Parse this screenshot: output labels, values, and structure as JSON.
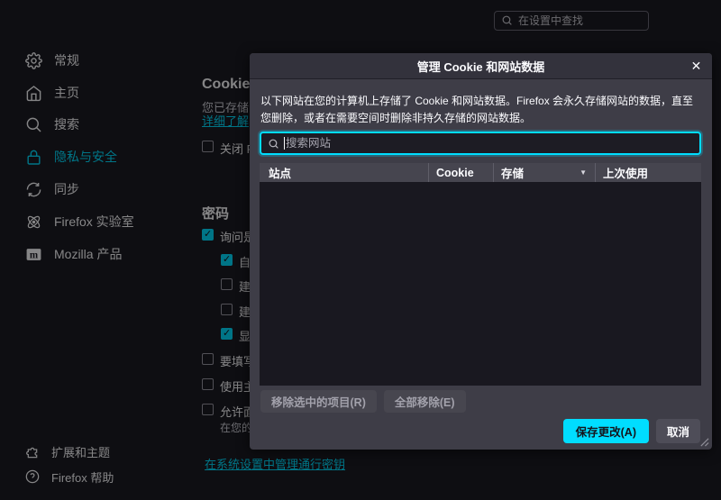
{
  "colors": {
    "accent": "#00ddff",
    "page_bg": "#1c1b22",
    "dialog_bg": "#3e3d47",
    "dialog_titlebar_bg": "#33323c",
    "table_header_bg": "#46454f",
    "table_body_bg": "#191820",
    "primary_button_text": "#15141a"
  },
  "page": {
    "top_search": {
      "placeholder": "在设置中查找"
    },
    "sidebar": {
      "items": [
        {
          "label": "常规"
        },
        {
          "label": "主页"
        },
        {
          "label": "搜索"
        },
        {
          "label": "隐私与安全"
        },
        {
          "label": "同步"
        },
        {
          "label": "Firefox 实验室"
        },
        {
          "label": "Mozilla 产品"
        }
      ],
      "footer": [
        {
          "label": "扩展和主题"
        },
        {
          "label": "Firefox 帮助"
        }
      ]
    },
    "content": {
      "cookie_heading": "Cookie",
      "cookie_desc": "您已存储的",
      "learn_more": "详细了解",
      "close_firefox_checkbox": "关闭 F",
      "passwords_heading": "密码",
      "checkboxes": [
        {
          "label": "询问是",
          "checked": true
        },
        {
          "label": "自",
          "checked": true
        },
        {
          "label": "建",
          "checked": false
        },
        {
          "label": "建",
          "checked": false
        },
        {
          "label": "显",
          "checked": true
        },
        {
          "label": "要填写",
          "checked": false
        },
        {
          "label": "使用主",
          "checked": false
        },
        {
          "label": "允许面",
          "checked": false
        }
      ],
      "checkbox_subtext": "在您的",
      "passkeys_link": "在系统设置中管理通行密钥"
    }
  },
  "dialog": {
    "title": "管理 Cookie 和网站数据",
    "close_label": "✕",
    "description": "以下网站在您的计算机上存储了 Cookie 和网站数据。Firefox 会永久存储网站的数据，直至您删除，或者在需要空间时删除非持久存储的网站数据。",
    "search_placeholder": "搜索网站",
    "table": {
      "columns": [
        "站点",
        "Cookie",
        "存储",
        "上次使用"
      ],
      "sort_indicator": "▼",
      "rows": []
    },
    "remove_selected_button": "移除选中的项目(R)",
    "remove_all_button": "全部移除(E)",
    "save_button": "保存更改(A)",
    "cancel_button": "取消"
  }
}
